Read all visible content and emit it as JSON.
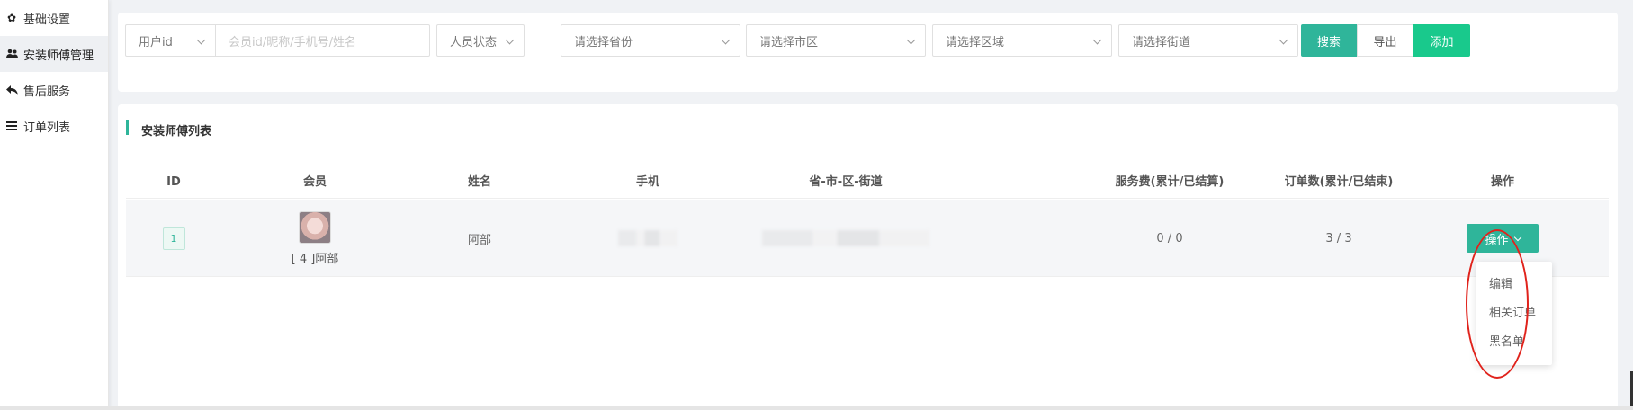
{
  "sidebar": {
    "items": [
      {
        "label": "基础设置",
        "icon": "gear-icon",
        "active": false
      },
      {
        "label": "安装师傅管理",
        "icon": "users-icon",
        "active": true
      },
      {
        "label": "售后服务",
        "icon": "reply-icon",
        "active": false
      },
      {
        "label": "订单列表",
        "icon": "list-icon",
        "active": false
      }
    ]
  },
  "filters": {
    "id_type": "用户id",
    "keyword_placeholder": "会员id/昵称/手机号/姓名",
    "status": "人员状态",
    "province": "请选择省份",
    "city": "请选择市区",
    "district": "请选择区域",
    "street": "请选择街道",
    "search_label": "搜索",
    "export_label": "导出",
    "add_label": "添加"
  },
  "list": {
    "title": "安装师傅列表",
    "columns": [
      "ID",
      "会员",
      "姓名",
      "手机",
      "省-市-区-街道",
      "服务费(累计/已结算)",
      "订单数(累计/已结束)",
      "操作"
    ],
    "rows": [
      {
        "id": "1",
        "member": "[ 4 ]阿部",
        "name": "阿部",
        "phone": "",
        "address": "",
        "service_fee": "0 / 0",
        "orders": "3 / 3",
        "action_label": "操作"
      }
    ]
  },
  "action_menu": [
    "编辑",
    "相关订单",
    "黑名单"
  ],
  "colors": {
    "accent": "#2fb59a",
    "add_button": "#19c98c",
    "annotation": "#e0231c"
  }
}
